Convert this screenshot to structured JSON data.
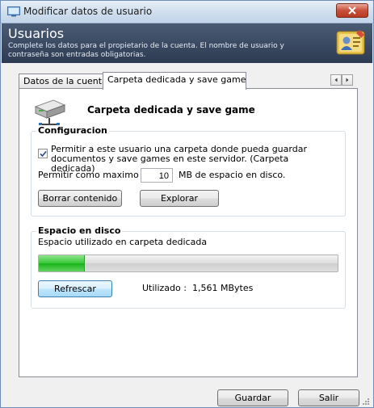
{
  "window": {
    "title": "Modificar datos de usuario"
  },
  "header": {
    "title": "Usuarios",
    "description": "Complete los datos para el propietario de la cuenta. El nombre de usuario y contraseña son entradas obligatorias."
  },
  "tabs": [
    {
      "label": "Datos de la cuenta",
      "active": false
    },
    {
      "label": "Carpeta dedicada y save game",
      "active": true
    }
  ],
  "section": {
    "title": "Carpeta dedicada y save game"
  },
  "config": {
    "legend": "Configuracion",
    "checkbox_label": "Permitir a este usuario una carpeta donde pueda guardar documentos y save games en este servidor. (Carpeta dedicada)",
    "checkbox_checked": true,
    "max_label": "Permitir como maximo",
    "max_value": "10",
    "max_unit": "MB de espacio en disco.",
    "clear_button": "Borrar contenido",
    "explore_button": "Explorar"
  },
  "disk": {
    "legend": "Espacio en disco",
    "usage_label": "Espacio utilizado en carpeta dedicada",
    "usage_fraction": 0.15,
    "refresh_button": "Refrescar",
    "used_label": "Utilizado :",
    "used_value": "1,561 MBytes"
  },
  "footer": {
    "save_button": "Guardar",
    "exit_button": "Salir"
  },
  "colors": {
    "progress_green": "#37c636",
    "header_bg": "#2d3b52"
  }
}
